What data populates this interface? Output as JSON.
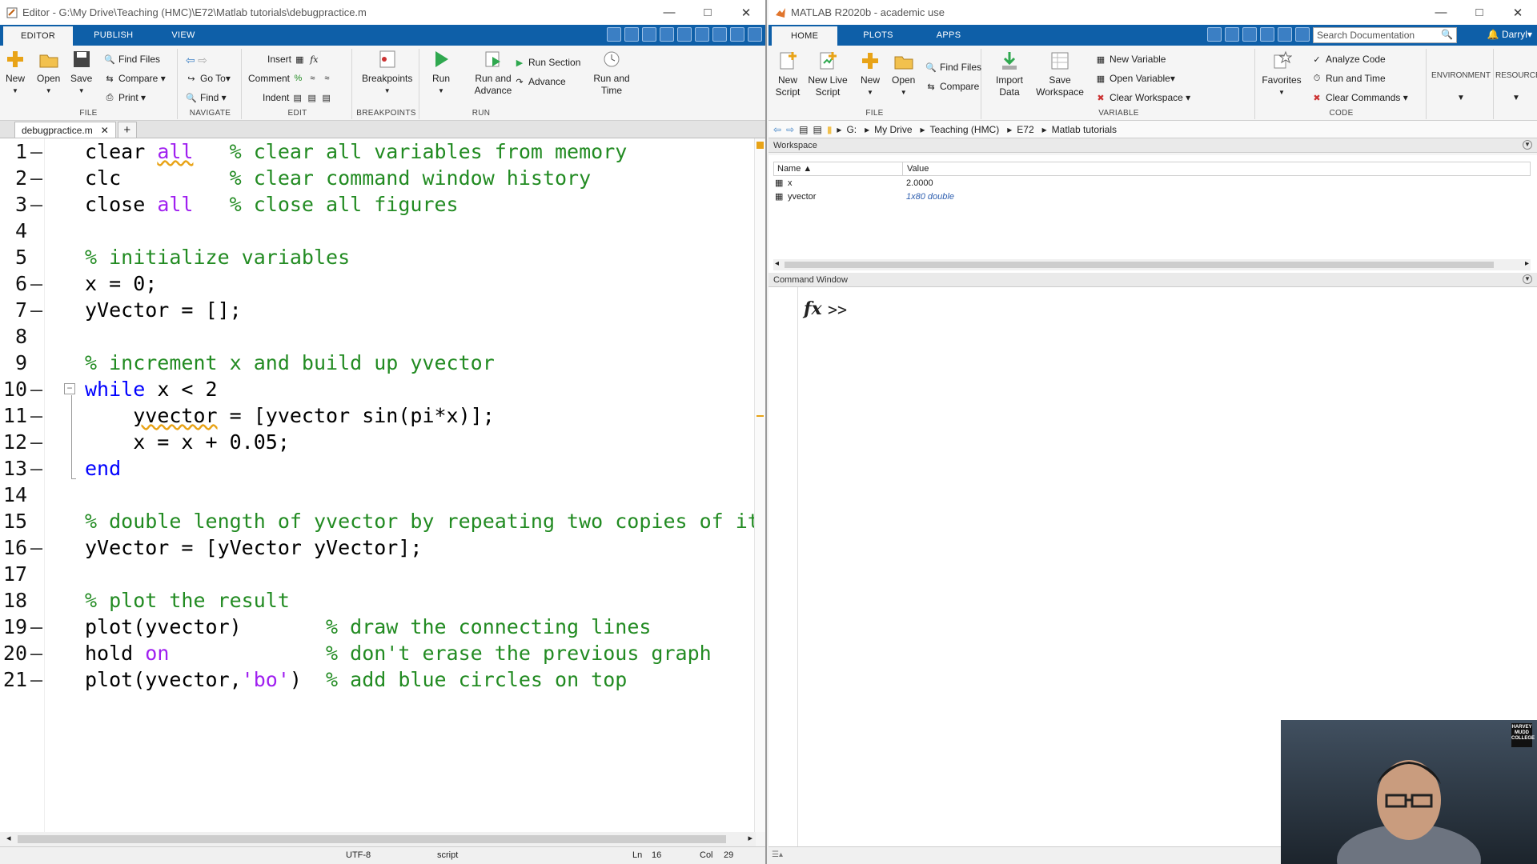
{
  "editor": {
    "title": "Editor - G:\\My Drive\\Teaching (HMC)\\E72\\Matlab tutorials\\debugpractice.m",
    "tabs": [
      "EDITOR",
      "PUBLISH",
      "VIEW"
    ],
    "file_group": {
      "label": "FILE",
      "new": "New",
      "open": "Open",
      "save": "Save",
      "find_files": "Find Files",
      "compare": "Compare",
      "print": "Print"
    },
    "navigate_group": {
      "label": "NAVIGATE",
      "go_to": "Go To",
      "find": "Find"
    },
    "edit_group": {
      "label": "EDIT",
      "insert": "Insert",
      "comment": "Comment",
      "indent": "Indent"
    },
    "breakpoints_group": {
      "label": "BREAKPOINTS",
      "breakpoints": "Breakpoints"
    },
    "run_group": {
      "label": "RUN",
      "run": "Run",
      "run_and_advance": "Run and Advance",
      "run_section": "Run Section",
      "advance": "Advance",
      "run_and_time": "Run and Time"
    },
    "doc_tab": "debugpractice.m",
    "code_lines": [
      "1",
      "2",
      "3",
      "4",
      "5",
      "6",
      "7",
      "8",
      "9",
      "10",
      "11",
      "12",
      "13",
      "14",
      "15",
      "16",
      "17",
      "18",
      "19",
      "20",
      "21"
    ],
    "status": {
      "encoding": "UTF-8",
      "type": "script",
      "ln_label": "Ln",
      "ln": "16",
      "col_label": "Col",
      "col": "29"
    }
  },
  "matlab": {
    "title": "MATLAB R2020b - academic use",
    "tabs": [
      "HOME",
      "PLOTS",
      "APPS"
    ],
    "search_placeholder": "Search Documentation",
    "user": "Darryl",
    "file_group": {
      "label": "FILE",
      "new_script": "New Script",
      "new_live_script": "New Live Script",
      "new": "New",
      "open": "Open",
      "find_files": "Find Files",
      "compare": "Compare"
    },
    "variable_group": {
      "label": "VARIABLE",
      "import_data": "Import Data",
      "save_workspace": "Save Workspace",
      "new_variable": "New Variable",
      "open_variable": "Open Variable",
      "clear_workspace": "Clear Workspace"
    },
    "code_group": {
      "label": "CODE",
      "favorites": "Favorites",
      "analyze_code": "Analyze Code",
      "run_and_time": "Run and Time",
      "clear_commands": "Clear Commands"
    },
    "environment": "ENVIRONMENT",
    "resources": "RESOURCES",
    "path": [
      "G:",
      "My Drive",
      "Teaching (HMC)",
      "E72",
      "Matlab tutorials"
    ],
    "workspace": {
      "title": "Workspace",
      "col_name": "Name",
      "col_value": "Value",
      "rows": [
        {
          "name": "x",
          "value": "2.0000"
        },
        {
          "name": "yvector",
          "value": "1x80 double"
        }
      ]
    },
    "command_window": {
      "title": "Command Window",
      "fx": "fx",
      "prompt": ">>"
    }
  },
  "webcam": {
    "logo": "HARVEY MUDD COLLEGE"
  },
  "colors": {
    "ribbon_blue": "#0e5fa8",
    "keyword": "#0000ff",
    "comment": "#228b22",
    "string": "#a020f0"
  }
}
